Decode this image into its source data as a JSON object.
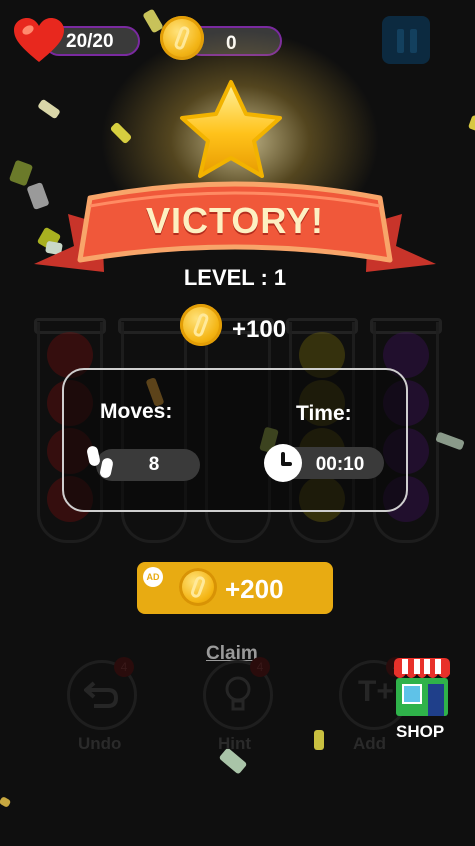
{
  "hud": {
    "lives": "20/20",
    "coins": "0"
  },
  "banner": {
    "title": "VICTORY!"
  },
  "level": {
    "text": "LEVEL : 1"
  },
  "reward": {
    "amount": "+100"
  },
  "stats": {
    "moves_label": "Moves:",
    "moves_value": "8",
    "time_label": "Time:",
    "time_value": "00:10"
  },
  "ad_button": {
    "badge": "AD",
    "amount": "+200"
  },
  "claim": {
    "label": "Claim"
  },
  "bottom_bar": {
    "undo_label": "Undo",
    "undo_count": "4",
    "hint_label": "Hint",
    "hint_count": "4",
    "add_label": "Add",
    "add_count": "4",
    "shop_label": "SHOP"
  },
  "colors": {
    "accent_gold": "#e8ab12",
    "banner_red": "#f0583a",
    "background": "#0f0f0f"
  }
}
